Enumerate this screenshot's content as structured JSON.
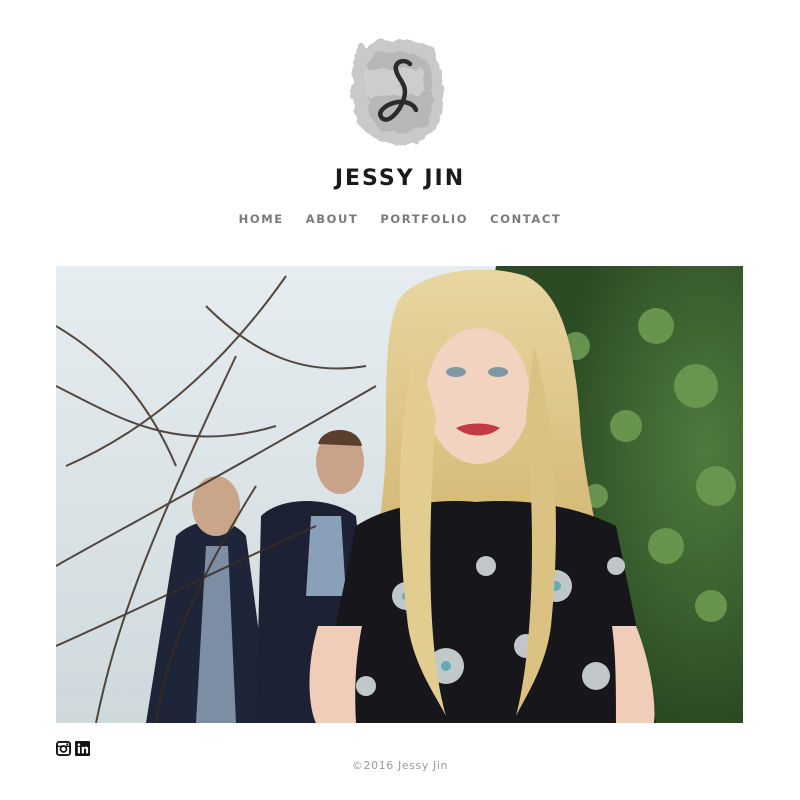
{
  "site": {
    "title": "JESSY JIN",
    "logo_icon": "brush-stroke-j-monogram-icon"
  },
  "nav": {
    "items": [
      {
        "label": "HOME"
      },
      {
        "label": "ABOUT"
      },
      {
        "label": "PORTFOLIO"
      },
      {
        "label": "CONTACT"
      }
    ]
  },
  "hero": {
    "image": "portrait-blonde-woman-floral-dress-with-two-men-behind-branches"
  },
  "social": {
    "icons": [
      "instagram-icon",
      "linkedin-icon"
    ]
  },
  "footer": {
    "copyright": "©2016 Jessy Jin"
  },
  "colors": {
    "title": "#1a1a1a",
    "nav": "#7a7a7a",
    "footer": "#9a9a9a",
    "background": "#ffffff"
  }
}
